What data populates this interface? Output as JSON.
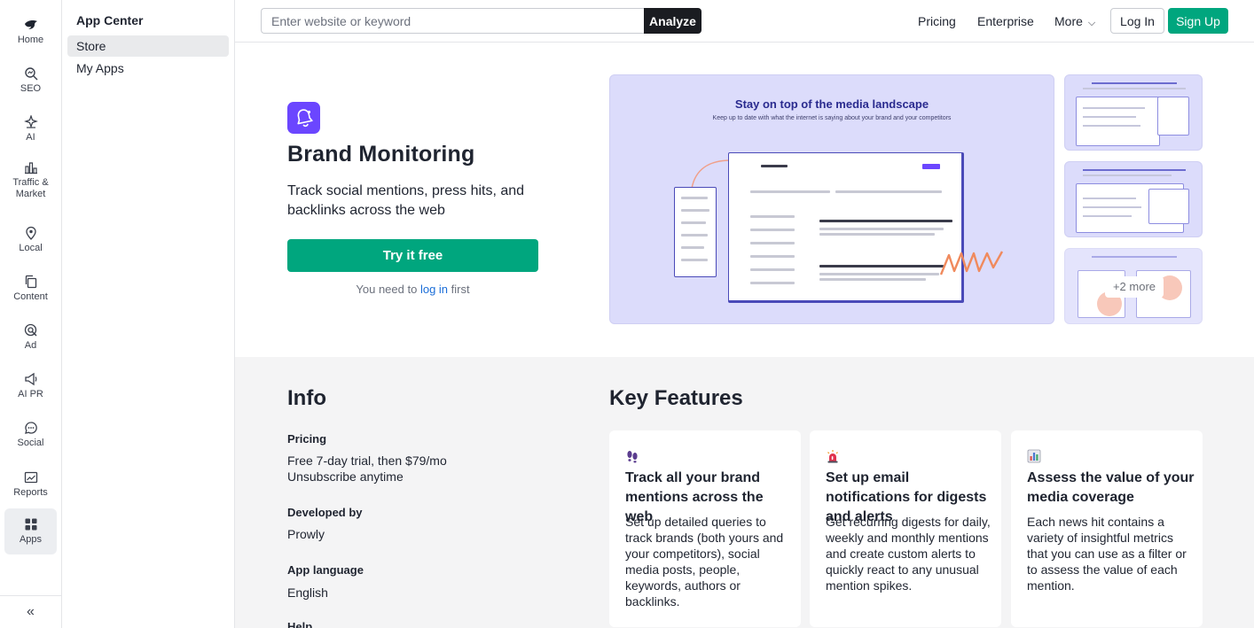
{
  "rail": {
    "items": [
      {
        "label": "Home",
        "icon": "bird-logo-icon"
      },
      {
        "label": "SEO",
        "icon": "seo-icon"
      },
      {
        "label": "AI",
        "icon": "ai-icon"
      },
      {
        "label": "Traffic & Market",
        "icon": "bar-chart-icon"
      },
      {
        "label": "Local",
        "icon": "map-pin-icon"
      },
      {
        "label": "Content",
        "icon": "copy-icon"
      },
      {
        "label": "Ad",
        "icon": "ad-target-icon"
      },
      {
        "label": "AI PR",
        "icon": "megaphone-icon"
      },
      {
        "label": "Social",
        "icon": "chat-bubble-icon"
      },
      {
        "label": "Reports",
        "icon": "reports-icon"
      },
      {
        "label": "Apps",
        "icon": "apps-grid-icon"
      }
    ],
    "collapse_icon": "double-chevron-left-icon"
  },
  "app_nav": {
    "title": "App Center",
    "items": [
      "Store",
      "My Apps"
    ]
  },
  "topbar": {
    "search_placeholder": "Enter website or keyword",
    "analyze_label": "Analyze",
    "links": [
      "Pricing",
      "Enterprise",
      "More"
    ],
    "login_label": "Log In",
    "signup_label": "Sign Up"
  },
  "hero": {
    "app_icon": "bell-icon",
    "title": "Brand Monitoring",
    "description": "Track social mentions, press hits, and backlinks across the web",
    "cta_label": "Try it free",
    "note_prefix": "You need to ",
    "note_link": "log in",
    "note_suffix": " first",
    "screenshot_title": "Stay on top of the media landscape",
    "screenshot_subtitle": "Keep up to date with what the internet is saying about your brand and your competitors",
    "more_label": "+2 more"
  },
  "info": {
    "title": "Info",
    "pricing_label": "Pricing",
    "pricing_line1": "Free 7-day trial, then $79/mo",
    "pricing_line2": "Unsubscribe anytime",
    "developer_label": "Developed by",
    "developer_value": "Prowly",
    "language_label": "App language",
    "language_value": "English",
    "help_label": "Help"
  },
  "features": {
    "title": "Key Features",
    "items": [
      {
        "icon": "footprints-icon",
        "title": "Track all your brand mentions across the web",
        "body": "Set up detailed queries to track brands (both yours and your competitors), social media posts, people, keywords, authors or backlinks."
      },
      {
        "icon": "siren-icon",
        "title": "Set up email notifications for digests and alerts",
        "body": "Get recurring digests for daily, weekly and monthly mentions and create custom alerts to quickly react to any unusual mention spikes."
      },
      {
        "icon": "bar-chart-emoji-icon",
        "title": "Assess the value of your media coverage",
        "body": "Each news hit contains a variety of insightful metrics that you can use as a filter or to assess the value of each mention."
      }
    ]
  },
  "colors": {
    "accent_green": "#00a67e",
    "app_icon_purple": "#6b46ff",
    "preview_bg": "#dcdcfb",
    "link_blue": "#1a6dd8"
  }
}
